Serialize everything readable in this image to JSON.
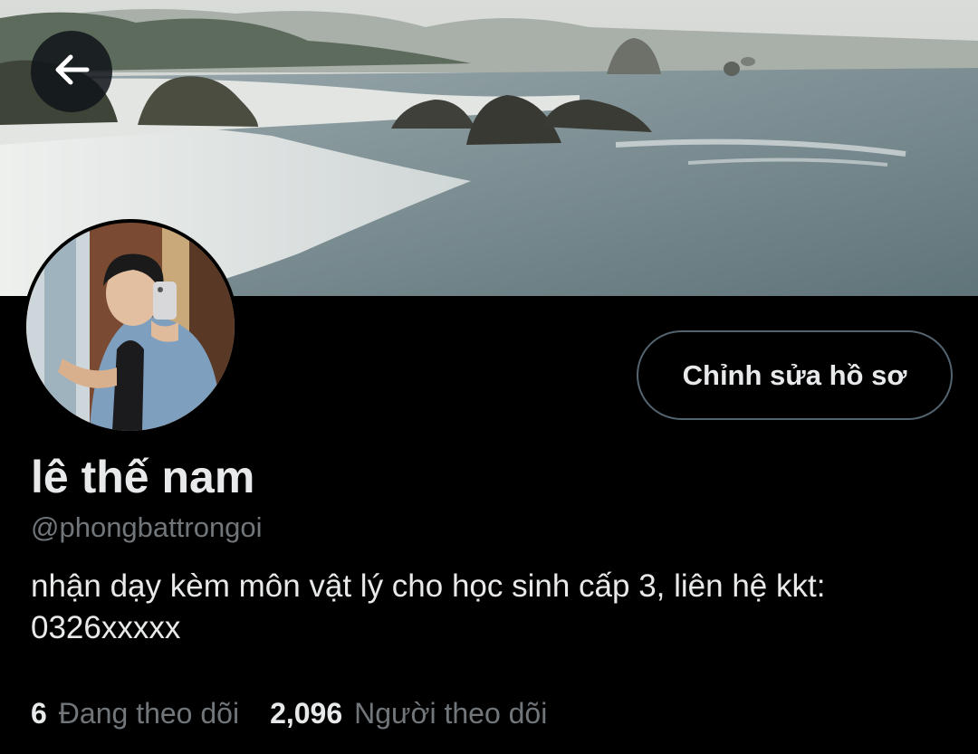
{
  "profile": {
    "display_name": "lê thế nam",
    "handle": "@phongbattrongoi",
    "bio": "nhận dạy kèm môn vật lý cho học sinh cấp 3, liên hệ kkt:\n0326xxxxx",
    "edit_button_label": "Chỉnh sửa hồ sơ",
    "following": {
      "count": "6",
      "label": "Đang theo dõi"
    },
    "followers": {
      "count": "2,096",
      "label": "Người theo dõi"
    }
  },
  "icons": {
    "back": "arrow-left-icon"
  },
  "colors": {
    "background": "#000000",
    "primary_text": "#e7e9ea",
    "secondary_text": "#71767b",
    "button_border": "#536471"
  }
}
